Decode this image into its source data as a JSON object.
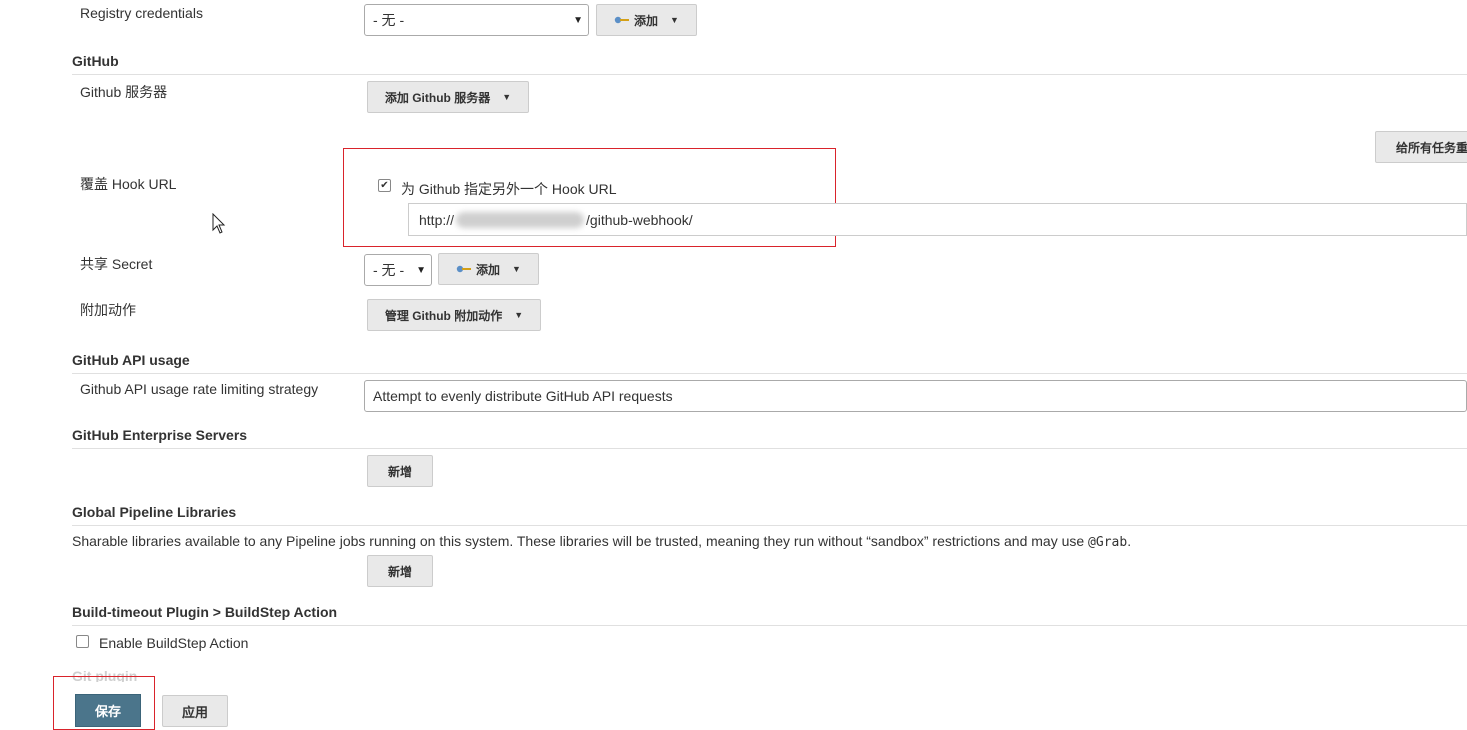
{
  "registry": {
    "label": "Registry credentials",
    "select_value": "- 无 -",
    "add_label": "添加"
  },
  "github": {
    "section_title": "GitHub",
    "servers_label": "Github 服务器",
    "add_server_label": "添加 Github 服务器",
    "re_register_label": "给所有任务重",
    "hook_url_label": "覆盖 Hook URL",
    "hook_checkbox_label": "为 Github 指定另外一个 Hook URL",
    "hook_checked": true,
    "hook_url_prefix": "http://",
    "hook_url_suffix": "/github-webhook/",
    "shared_secret_label": "共享 Secret",
    "shared_secret_value": "- 无 -",
    "shared_secret_add": "添加",
    "additional_actions_label": "附加动作",
    "manage_actions_label": "管理 Github 附加动作"
  },
  "api_usage": {
    "section_title": "GitHub API usage",
    "strategy_label": "Github API usage rate limiting strategy",
    "strategy_value": "Attempt to evenly distribute GitHub API requests"
  },
  "enterprise": {
    "section_title": "GitHub Enterprise Servers",
    "add_label": "新增"
  },
  "pipeline_libs": {
    "section_title": "Global Pipeline Libraries",
    "description_text": "Sharable libraries available to any Pipeline jobs running on this system. These libraries will be trusted, meaning they run without “sandbox” restrictions and may use",
    "description_code": "@Grab",
    "description_end": ".",
    "add_label": "新增"
  },
  "build_timeout": {
    "section_title": "Build-timeout Plugin > BuildStep Action",
    "enable_label": "Enable BuildStep Action",
    "enabled": false
  },
  "git_plugin": {
    "section_title": "Git plugin"
  },
  "footer": {
    "save_label": "保存",
    "apply_label": "应用"
  },
  "colors": {
    "highlight_border": "#d9232b",
    "save_button": "#4b758b"
  }
}
